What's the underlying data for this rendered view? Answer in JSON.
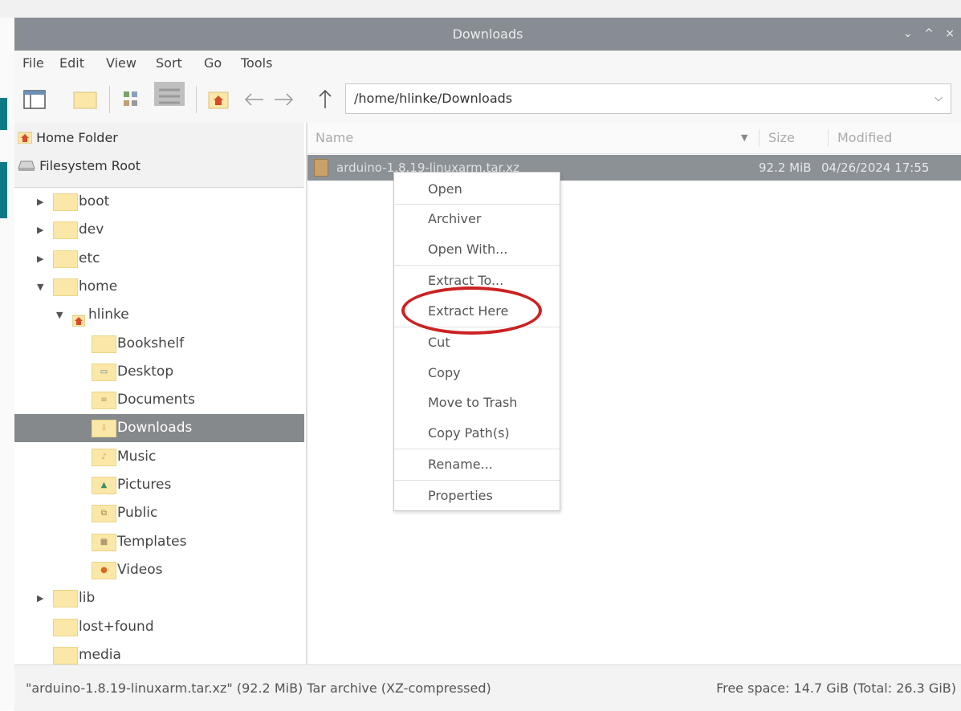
{
  "window": {
    "title": "Downloads",
    "controls": [
      "⌄",
      "^",
      "×"
    ]
  },
  "menu": [
    "File",
    "Edit",
    "View",
    "Sort",
    "Go",
    "Tools"
  ],
  "toolbar": {
    "path": "/home/hlinke/Downloads"
  },
  "places": [
    {
      "label": "Home Folder",
      "icon": "home-icon"
    },
    {
      "label": "Filesystem Root",
      "icon": "drive-icon"
    }
  ],
  "tree": [
    {
      "label": "boot",
      "expand": "collapsed"
    },
    {
      "label": "dev",
      "expand": "collapsed"
    },
    {
      "label": "etc",
      "expand": "collapsed"
    },
    {
      "label": "home",
      "expand": "expanded"
    },
    {
      "label": "hlinke",
      "expand": "expanded"
    },
    {
      "label": "Bookshelf",
      "expand": "none"
    },
    {
      "label": "Desktop",
      "expand": "none"
    },
    {
      "label": "Documents",
      "expand": "none"
    },
    {
      "label": "Downloads",
      "expand": "none",
      "selected": true
    },
    {
      "label": "Music",
      "expand": "none"
    },
    {
      "label": "Pictures",
      "expand": "none"
    },
    {
      "label": "Public",
      "expand": "none"
    },
    {
      "label": "Templates",
      "expand": "none"
    },
    {
      "label": "Videos",
      "expand": "none"
    },
    {
      "label": "lib",
      "expand": "collapsed"
    },
    {
      "label": "lost+found",
      "expand": "none"
    },
    {
      "label": "media",
      "expand": "none"
    }
  ],
  "columns": {
    "name": "Name",
    "size": "Size",
    "modified": "Modified"
  },
  "file": {
    "name": "arduino-1.8.19-linuxarm.tar.xz",
    "size": "92.2 MiB",
    "modified": "04/26/2024 17:55"
  },
  "context_menu": [
    "Open",
    "Archiver",
    "Open With...",
    "Extract To...",
    "Extract Here",
    "Cut",
    "Copy",
    "Move to Trash",
    "Copy Path(s)",
    "Rename...",
    "Properties"
  ],
  "status": {
    "left": "\"arduino-1.8.19-linuxarm.tar.xz\" (92.2 MiB) Tar archive (XZ-compressed)",
    "right": "Free space: 14.7 GiB (Total: 26.3 GiB)"
  },
  "colors": {
    "titlebar": "#878d93",
    "selection": "#86898c",
    "highlight_circle": "#cc2222",
    "folder": "#fbe7a7"
  }
}
